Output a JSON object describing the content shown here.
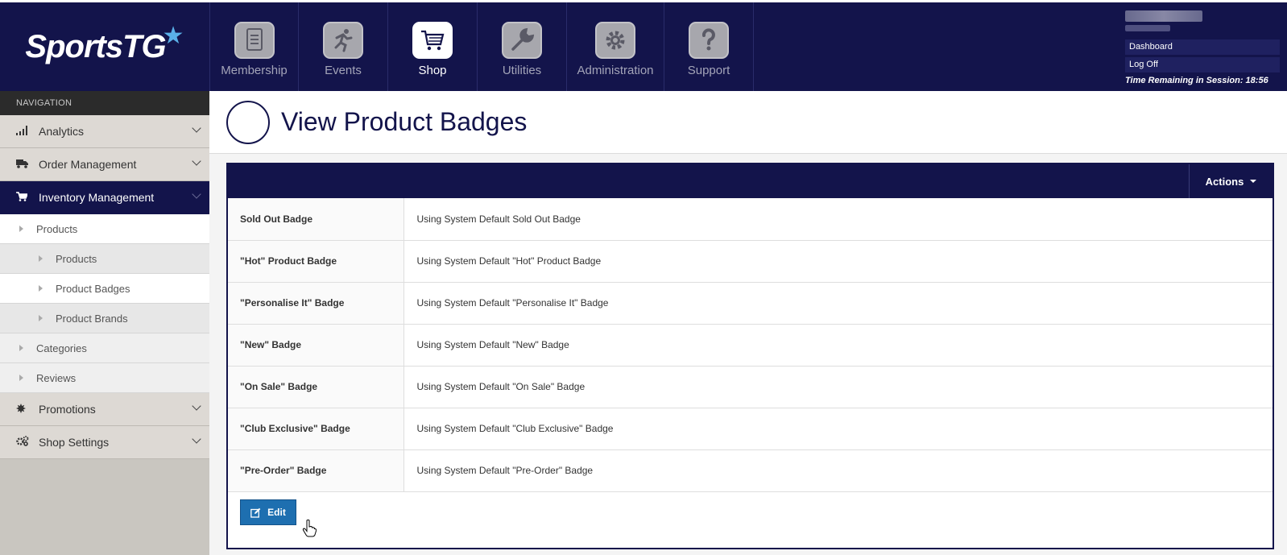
{
  "brand": {
    "name": "SportsTG",
    "star": "★"
  },
  "topnav": [
    {
      "label": "Membership",
      "icon": "membership-icon"
    },
    {
      "label": "Events",
      "icon": "events-icon"
    },
    {
      "label": "Shop",
      "icon": "shop-cart-icon",
      "active": true
    },
    {
      "label": "Utilities",
      "icon": "utilities-wrench-icon"
    },
    {
      "label": "Administration",
      "icon": "administration-gear-icon"
    },
    {
      "label": "Support",
      "icon": "support-question-icon"
    }
  ],
  "user": {
    "dashboard": "Dashboard",
    "logoff": "Log Off",
    "session": "Time Remaining in Session: 18:56"
  },
  "sidebar": {
    "heading": "NAVIGATION",
    "sections": [
      {
        "label": "Analytics"
      },
      {
        "label": "Order Management"
      },
      {
        "label": "Inventory Management"
      },
      {
        "label": "Promotions"
      },
      {
        "label": "Shop Settings"
      }
    ],
    "sub": {
      "products": "Products",
      "products_child": "Products",
      "product_badges": "Product Badges",
      "product_brands": "Product Brands",
      "categories": "Categories",
      "reviews": "Reviews"
    }
  },
  "page": {
    "title": "View Product Badges"
  },
  "panel": {
    "actions": "Actions",
    "rows": [
      {
        "label": "Sold Out Badge",
        "value": "Using System Default Sold Out Badge"
      },
      {
        "label": "\"Hot\" Product Badge",
        "value": "Using System Default \"Hot\" Product Badge"
      },
      {
        "label": "\"Personalise It\" Badge",
        "value": "Using System Default \"Personalise It\" Badge"
      },
      {
        "label": "\"New\" Badge",
        "value": "Using System Default \"New\" Badge"
      },
      {
        "label": "\"On Sale\" Badge",
        "value": "Using System Default \"On Sale\" Badge"
      },
      {
        "label": "\"Club Exclusive\" Badge",
        "value": "Using System Default \"Club Exclusive\" Badge"
      },
      {
        "label": "\"Pre-Order\" Badge",
        "value": "Using System Default \"Pre-Order\" Badge"
      }
    ],
    "edit": "Edit"
  },
  "colors": {
    "navy": "#13144b",
    "button_blue": "#1e6fb0",
    "sidebar_grey": "#c9c6c0"
  }
}
